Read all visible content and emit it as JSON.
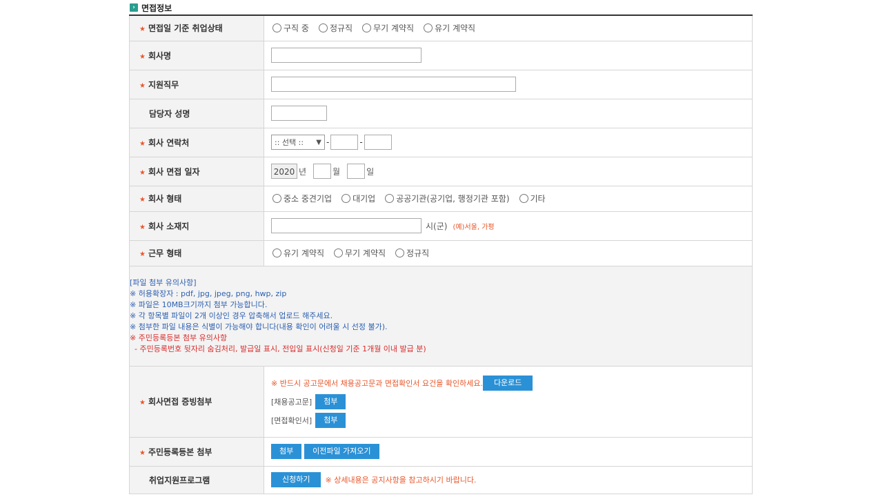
{
  "section": {
    "title": "면접정보",
    "icon": "›"
  },
  "rows": {
    "status": {
      "label": "면접일 기준 취업상태",
      "options": [
        "구직 중",
        "정규직",
        "무기 계약직",
        "유기 계약직"
      ]
    },
    "company_name": {
      "label": "회사명"
    },
    "job": {
      "label": "지원직무"
    },
    "manager": {
      "label": "담당자 성명"
    },
    "phone": {
      "label": "회사 연락처",
      "select": ":: 선택 ::",
      "dash": "-"
    },
    "date": {
      "label": "회사 면접 일자",
      "year": "2020",
      "unit_year": "년",
      "unit_month": "월",
      "unit_day": "일"
    },
    "type": {
      "label": "회사 형태",
      "options": [
        "중소 중견기업",
        "대기업",
        "공공기관(공기업, 행정기관 포함)",
        "기타"
      ]
    },
    "location": {
      "label": "회사 소재지",
      "unit": "시(군)",
      "example": "(예)서울, 가평"
    },
    "work": {
      "label": "근무 형태",
      "options": [
        "유기 계약직",
        "무기 계약직",
        "정규직"
      ]
    }
  },
  "notice": {
    "lines_blue": [
      "[파일 첨부 유의사항]",
      "※ 허용확장자 : pdf, jpg, jpeg, png, hwp, zip",
      "※ 파일은 10MB크기까지 첨부 가능합니다.",
      "※ 각 항목별 파일이 2개 이상인 경우 압축해서 업로드 해주세요.",
      "※ 첨부한 파일 내용은 식별이 가능해야 합니다(내용 확인이 어려울 시 선정 불가)."
    ],
    "lines_red": [
      "※ 주민등록등본 첨부 유의사항",
      "  - 주민등록번호 뒷자리 숨김처리, 발급일 표시, 전입일 표시(신청일 기준 1개월 이내 발급 분)"
    ]
  },
  "proof": {
    "label": "회사면접 증빙첨부",
    "note": "※ 반드시 공고문에서 채용공고문과 면접확인서 요건을 확인하세요.",
    "download": "다운로드",
    "item1": "[채용공고문]",
    "item2": "[면접확인서]",
    "attach": "첨부"
  },
  "resident": {
    "label": "주민등록등본 첨부",
    "attach": "첨부",
    "prev": "이전파일 가져오기"
  },
  "program": {
    "label": "취업지원프로그램",
    "apply": "신청하기",
    "note": "※ 상세내용은 공지사항을 참고하시기 바랍니다."
  },
  "colors": {
    "accent": "#2b91d6",
    "required": "#e8562a",
    "notice_blue": "#2b5fb0",
    "notice_red": "#d92b2b"
  }
}
